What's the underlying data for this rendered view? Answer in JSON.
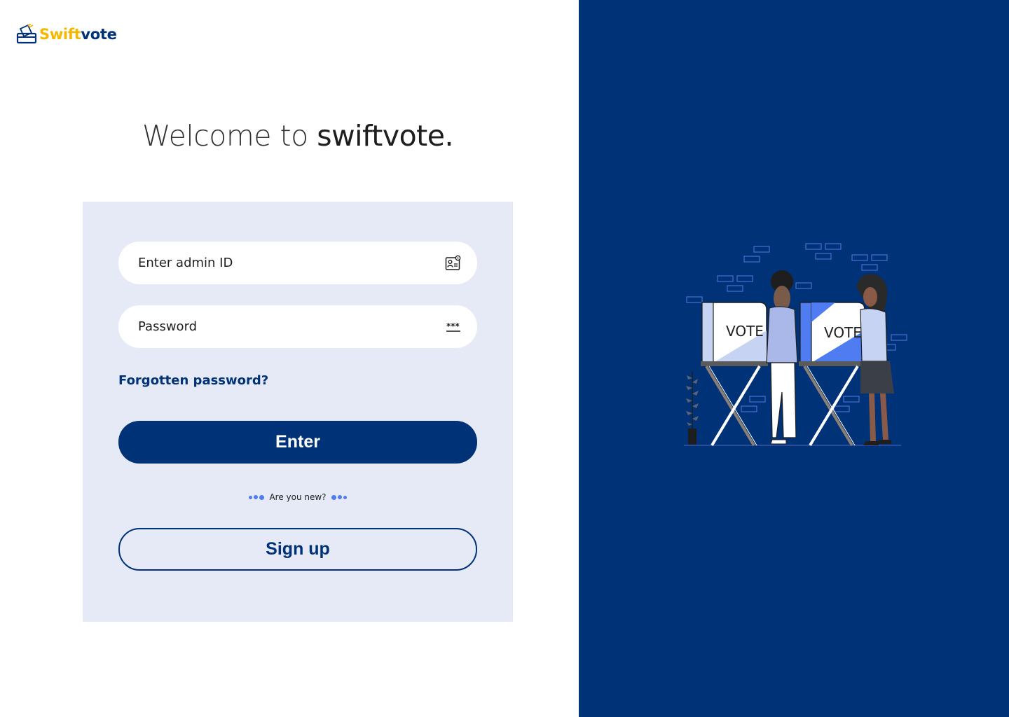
{
  "brand": {
    "name_part1": "Swift",
    "name_part2": "vote",
    "color_primary": "#003278",
    "color_accent": "#f5b800",
    "icon": "ballot-box-icon"
  },
  "welcome": {
    "prefix": "Welcome to ",
    "app_name": "swiftvote."
  },
  "form": {
    "admin_id_placeholder": "Enter admin ID",
    "admin_id_icon": "id-card-icon",
    "password_placeholder": "Password",
    "password_icon": "password-dots-icon",
    "forgot_label": "Forgotten password?",
    "enter_label": "Enter",
    "new_prompt": "Are you new?",
    "signup_label": "Sign up"
  },
  "illustration": {
    "booth_label_1": "VOTE",
    "booth_label_2": "VOTE"
  }
}
